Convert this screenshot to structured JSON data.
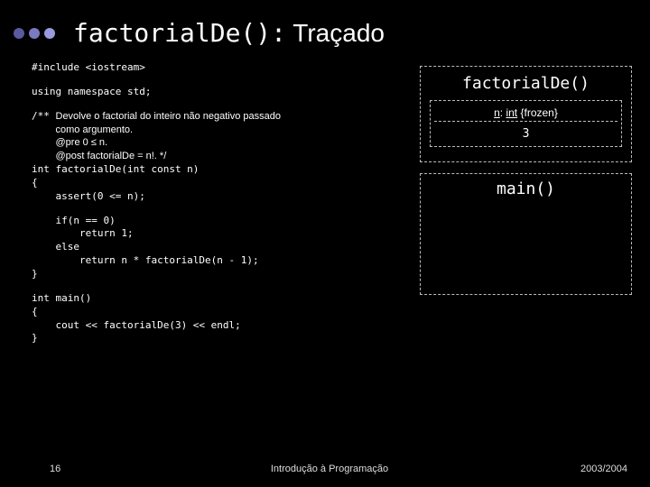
{
  "header": {
    "title_code": "factorialDe():",
    "title_trace": " Traçado"
  },
  "code": {
    "include": "#include <iostream>",
    "using": "using namespace std;",
    "doc_lead": "/** ",
    "doc_line1": "Devolve o factorial do inteiro não negativo passado",
    "doc_line2": "como argumento.",
    "doc_line3": "@pre 0 ≤ n.",
    "doc_line4": "@post factorialDe = n!. */",
    "sig": "int factorialDe(int const n)\n{\n    assert(0 <= n);",
    "body": "    if(n == 0)\n        return 1;\n    else\n        return n * factorialDe(n - 1);\n}",
    "main": "int main()\n{\n    cout << factorialDe(3) << endl;\n}"
  },
  "stack": {
    "frame1_title": "factorialDe()",
    "var_name": "n",
    "var_type": "int",
    "var_qual": "{frozen}",
    "var_value": "3",
    "frame2_title": "main()"
  },
  "footer": {
    "slide": "16",
    "title": "Introdução à Programação",
    "year": "2003/2004"
  }
}
